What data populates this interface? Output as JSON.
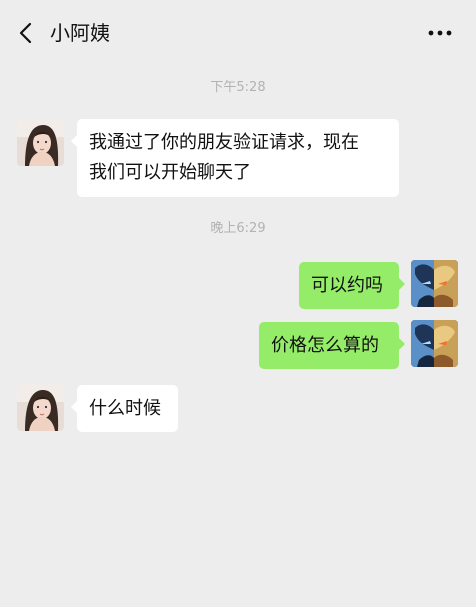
{
  "header": {
    "title": "小阿姨",
    "back_icon": "chevron-left-icon",
    "more_icon": "more-dots-icon"
  },
  "messages": [
    {
      "type": "time",
      "text": "下午5:28"
    },
    {
      "type": "received",
      "lines": [
        "我通过了你的朋友验证请求，现在",
        "我们可以开始聊天了"
      ]
    },
    {
      "type": "time",
      "text": "晚上6:29"
    },
    {
      "type": "sent",
      "text": "可以约吗"
    },
    {
      "type": "sent",
      "text": "价格怎么算的"
    },
    {
      "type": "received",
      "text": "什么时候"
    }
  ],
  "colors": {
    "background": "#ededed",
    "sent_bubble": "#95ec69",
    "received_bubble": "#ffffff",
    "timestamp": "#b2b2b2"
  }
}
